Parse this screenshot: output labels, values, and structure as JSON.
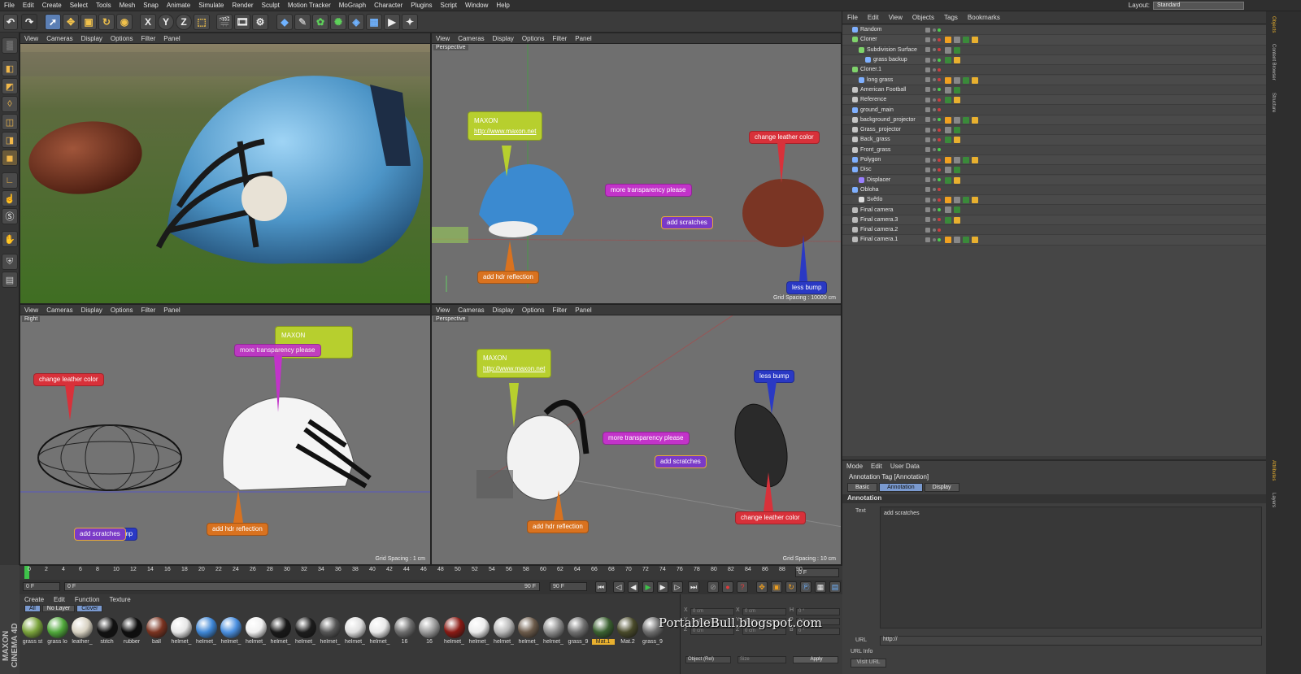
{
  "menubar": {
    "items": [
      "File",
      "Edit",
      "Create",
      "Select",
      "Tools",
      "Mesh",
      "Snap",
      "Animate",
      "Simulate",
      "Render",
      "Sculpt",
      "Motion Tracker",
      "MoGraph",
      "Character",
      "Plugins",
      "Script",
      "Window",
      "Help"
    ],
    "layout_label": "Layout:",
    "layout_value": "Standard"
  },
  "toolbar": {
    "axis_x": "X",
    "axis_y": "Y",
    "axis_z": "Z"
  },
  "viewport_menu": [
    "View",
    "Cameras",
    "Display",
    "Options",
    "Filter",
    "Panel"
  ],
  "viewports": {
    "tl": {
      "label": ""
    },
    "tr": {
      "label": "Perspective",
      "grid": "Grid Spacing : 10000 cm"
    },
    "bl": {
      "label": "Right",
      "grid": "Grid Spacing : 1 cm"
    },
    "br": {
      "label": "Perspective",
      "grid": "Grid Spacing : 10 cm"
    }
  },
  "annotations": {
    "maxon_title": "MAXON",
    "maxon_url": "http://www.maxon.net",
    "change_leather": "change leather color",
    "more_transparency": "more transparency please",
    "add_scratches": "add scratches",
    "add_hdr": "add hdr reflection",
    "less_bump": "less bump",
    "bl_overlap": "add scratches",
    "bl_overlap_tail": "mp"
  },
  "object_manager": {
    "menu": [
      "File",
      "Edit",
      "View",
      "Objects",
      "Tags",
      "Bookmarks"
    ],
    "rows": [
      {
        "name": "Random",
        "indent": 0,
        "icon": "#7fb0ff"
      },
      {
        "name": "Cloner",
        "indent": 0,
        "icon": "#7fd36b"
      },
      {
        "name": "Subdivision Surface",
        "indent": 1,
        "icon": "#7fd36b"
      },
      {
        "name": "grass backup",
        "indent": 2,
        "icon": "#7fb0ff"
      },
      {
        "name": "Cloner.1",
        "indent": 0,
        "icon": "#7fd36b"
      },
      {
        "name": "long grass",
        "indent": 1,
        "icon": "#7fb0ff"
      },
      {
        "name": "American Football",
        "indent": 0,
        "icon": "#c6c6c6"
      },
      {
        "name": "Reference",
        "indent": 0,
        "icon": "#c6c6c6"
      },
      {
        "name": "ground_main",
        "indent": 0,
        "icon": "#7fb0ff"
      },
      {
        "name": "background_projector",
        "indent": 0,
        "icon": "#c6c6c6"
      },
      {
        "name": "Grass_projector",
        "indent": 0,
        "icon": "#c6c6c6"
      },
      {
        "name": "Back_grass",
        "indent": 0,
        "icon": "#c6c6c6"
      },
      {
        "name": "Front_grass",
        "indent": 0,
        "icon": "#c6c6c6"
      },
      {
        "name": "Polygon",
        "indent": 0,
        "icon": "#7fb0ff"
      },
      {
        "name": "Disc",
        "indent": 0,
        "icon": "#7fb0ff"
      },
      {
        "name": "Displacer",
        "indent": 1,
        "icon": "#9a7fff"
      },
      {
        "name": "Obloha",
        "indent": 0,
        "icon": "#7fb0ff"
      },
      {
        "name": "Světlo",
        "indent": 1,
        "icon": "#dddddd"
      },
      {
        "name": "Final camera",
        "indent": 0,
        "icon": "#bbbbbb"
      },
      {
        "name": "Final camera.3",
        "indent": 0,
        "icon": "#bbbbbb"
      },
      {
        "name": "Final camera.2",
        "indent": 0,
        "icon": "#bbbbbb"
      },
      {
        "name": "Final camera.1",
        "indent": 0,
        "icon": "#bbbbbb"
      }
    ],
    "side_tabs": [
      "Objects",
      "Content Browser",
      "Structure"
    ]
  },
  "attributes": {
    "menu": [
      "Mode",
      "Edit",
      "User Data"
    ],
    "title": "Annotation Tag [Annotation]",
    "tabs": [
      "Basic",
      "Annotation",
      "Display"
    ],
    "active_tab": "Annotation",
    "section": "Annotation",
    "text_label": "Text",
    "text_value": "add scratches",
    "url_label": "URL",
    "url_value": "http://",
    "url_info_label": "URL Info",
    "visit_button": "Visit URL",
    "side_tabs": [
      "Attributes",
      "Layers"
    ]
  },
  "timeline": {
    "ticks": [
      "0",
      "2",
      "4",
      "6",
      "8",
      "10",
      "12",
      "14",
      "16",
      "18",
      "20",
      "22",
      "24",
      "26",
      "28",
      "30",
      "32",
      "34",
      "36",
      "38",
      "40",
      "42",
      "44",
      "46",
      "48",
      "50",
      "52",
      "54",
      "56",
      "58",
      "60",
      "62",
      "64",
      "66",
      "68",
      "70",
      "72",
      "74",
      "76",
      "78",
      "80",
      "82",
      "84",
      "86",
      "88",
      "90"
    ],
    "current_frame": "0 F",
    "end_frame_field": "0 F"
  },
  "transport": {
    "start": "0 F",
    "range_left": "0 F",
    "range_right": "90 F",
    "end": "90 F"
  },
  "material_manager": {
    "menu": [
      "Create",
      "Edit",
      "Function",
      "Texture"
    ],
    "tabs": [
      "All",
      "No Layer",
      "Clover"
    ],
    "materials": [
      {
        "label": "grass st",
        "color": "#7aa33b"
      },
      {
        "label": "grass lo",
        "color": "#4fa83a"
      },
      {
        "label": "leather_",
        "color": "#d8d2c2"
      },
      {
        "label": "stitch",
        "color": "#111111"
      },
      {
        "label": "rubber",
        "color": "#0d0d0d"
      },
      {
        "label": "ball",
        "color": "#7a3320"
      },
      {
        "label": "helmet_",
        "color": "#e6e6e6"
      },
      {
        "label": "helmet_",
        "color": "#3e86d6"
      },
      {
        "label": "helmet_",
        "color": "#4a8fe0"
      },
      {
        "label": "helmet_",
        "color": "#f0f0f0"
      },
      {
        "label": "helmet_",
        "color": "#181818"
      },
      {
        "label": "helmet_",
        "color": "#1c1c1c"
      },
      {
        "label": "helmet_",
        "color": "#555555"
      },
      {
        "label": "helmet_",
        "color": "#dedede"
      },
      {
        "label": "helmet_",
        "color": "#e9e9e9"
      },
      {
        "label": "16",
        "color": "#6d6d6d"
      },
      {
        "label": "16",
        "color": "#9a9a9a"
      },
      {
        "label": "helmet_",
        "color": "#8a1a14"
      },
      {
        "label": "helmet_",
        "color": "#ececec"
      },
      {
        "label": "helmet_",
        "color": "#b8b8b8"
      },
      {
        "label": "helmet_",
        "color": "#6b5a4a"
      },
      {
        "label": "helmet_",
        "color": "#8b8b8b"
      },
      {
        "label": "grass_9",
        "color": "#707070"
      },
      {
        "label": "Mat.1",
        "color": "#3a6030"
      },
      {
        "label": "Mat.2",
        "color": "#494a2a"
      },
      {
        "label": "grass_9",
        "color": "#6d6d6d"
      }
    ],
    "highlighted_index": 23
  },
  "coordinates": {
    "rows": [
      {
        "a": "X",
        "av": "0 cm",
        "b": "X",
        "bv": "0 cm",
        "c": "H",
        "cv": "0 °"
      },
      {
        "a": "Y",
        "av": "0 cm",
        "b": "Y",
        "bv": "0 cm",
        "c": "P",
        "cv": "0 °"
      },
      {
        "a": "Z",
        "av": "0 cm",
        "b": "Z",
        "bv": "0 cm",
        "c": "B",
        "cv": "0 °"
      }
    ],
    "mode": "Object (Rel)",
    "size": "Size",
    "apply": "Apply"
  },
  "watermark": "PortableBull.blogspot.com",
  "brand": "MAXON CINEMA 4D",
  "colors": {
    "maxon_note": "#b7cf2e",
    "leather_note": "#d8313a",
    "transparency_note": "#c233c9",
    "scratches_note": "#7a3ac7",
    "hdr_note": "#d9721f",
    "bump_note": "#2a39c4"
  }
}
